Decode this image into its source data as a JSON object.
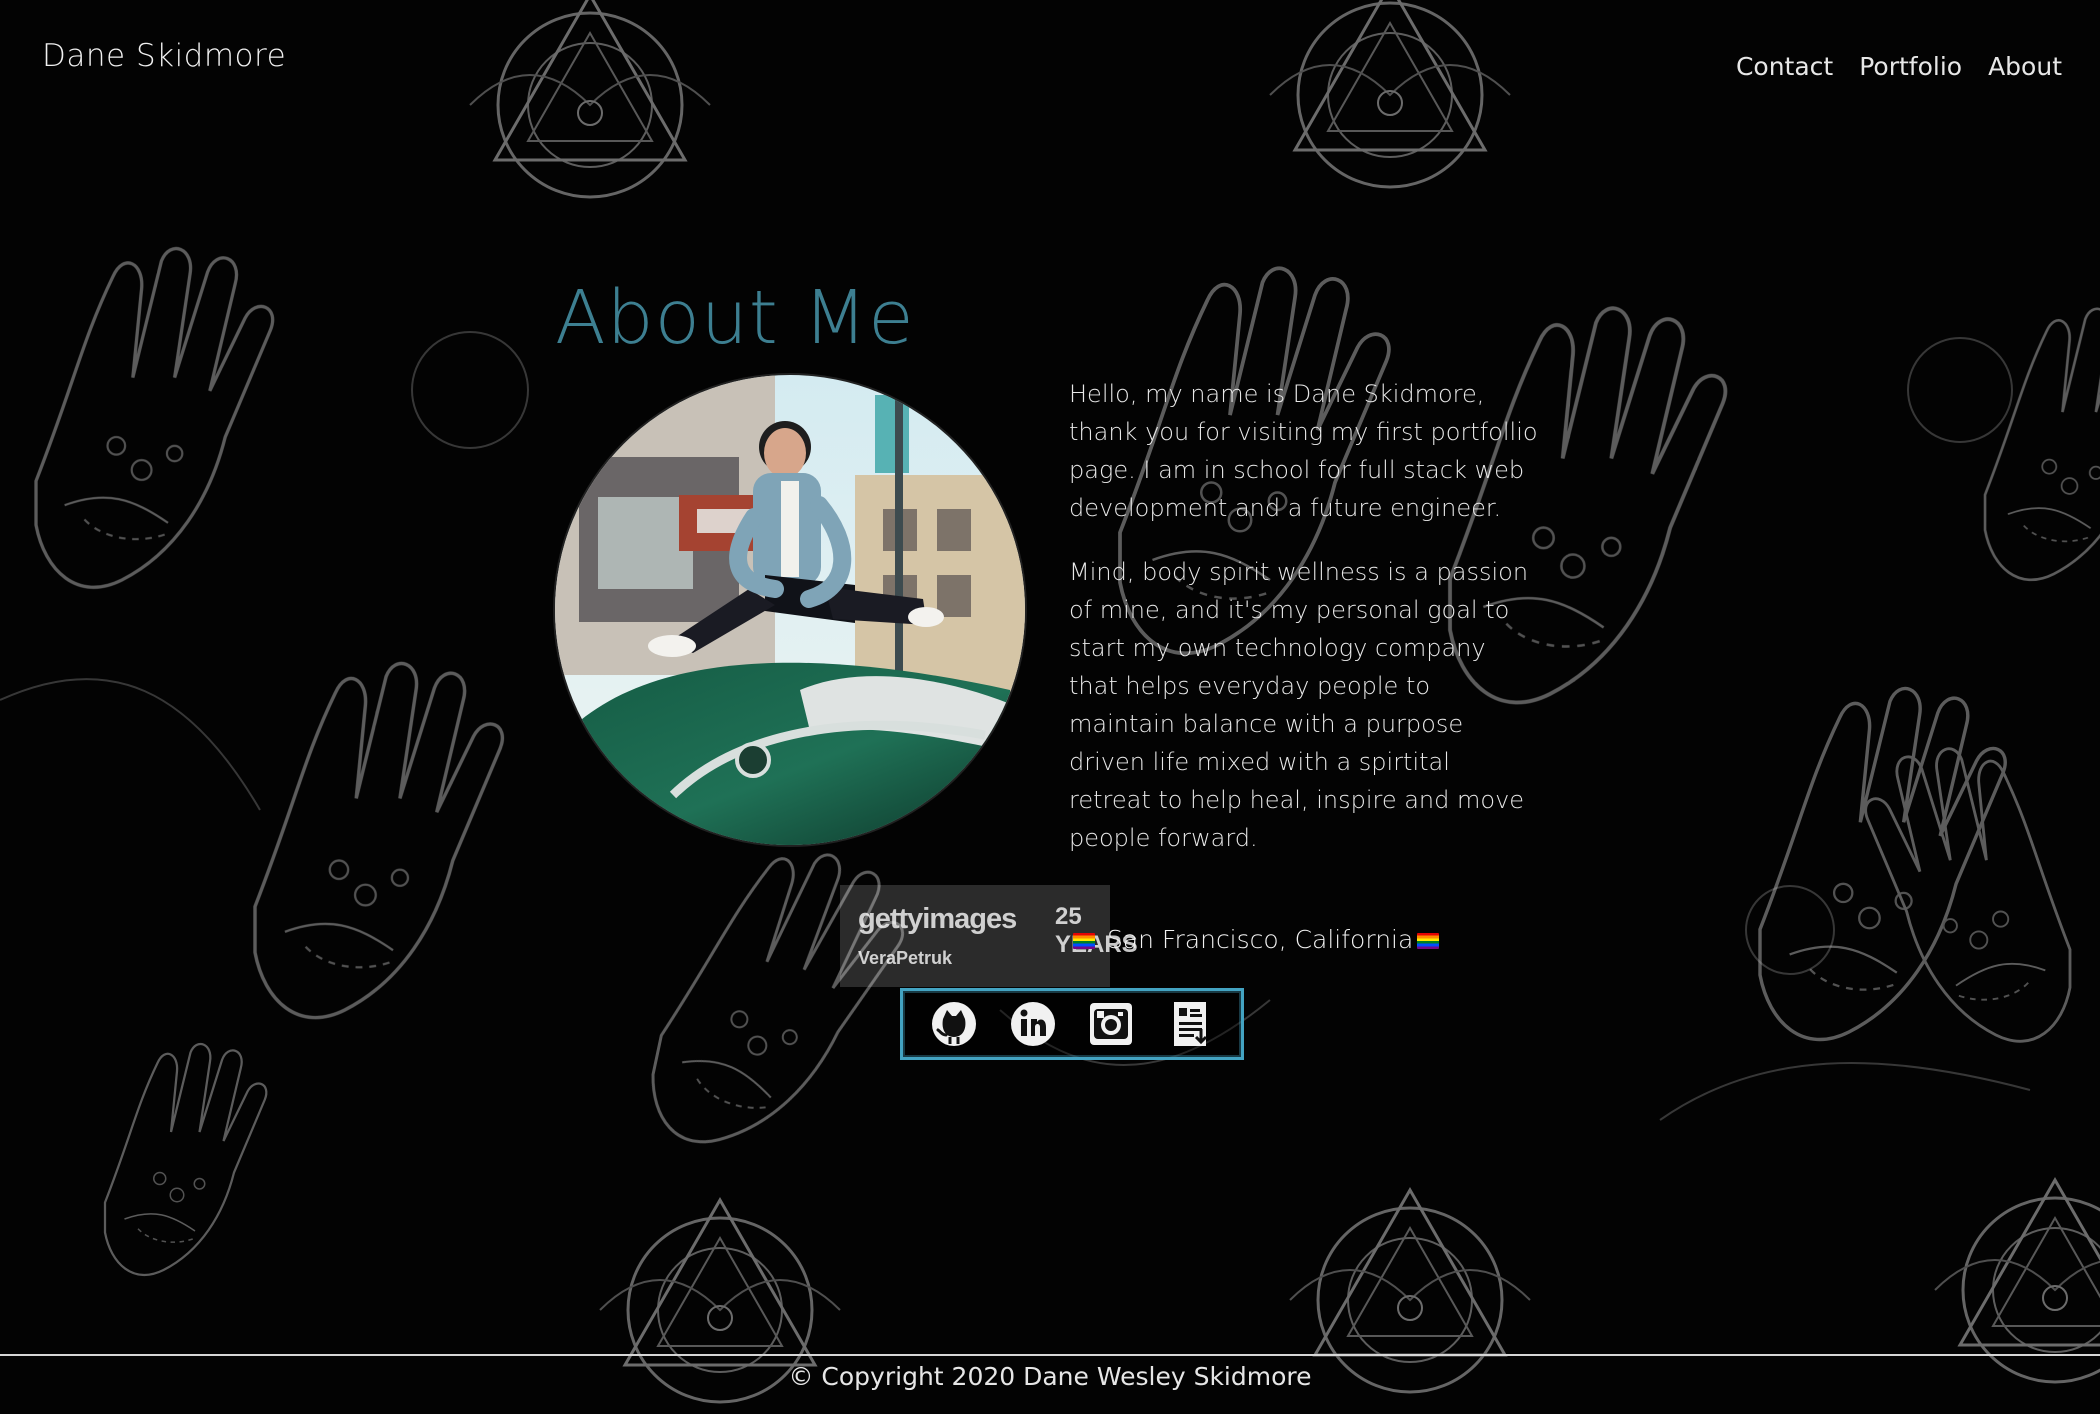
{
  "header": {
    "brand": "Dane Skidmore",
    "nav": [
      {
        "label": "Contact"
      },
      {
        "label": "Portfolio"
      },
      {
        "label": "About"
      }
    ]
  },
  "main": {
    "title": "About Me",
    "paragraphs": [
      "Hello, my name is Dane Skidmore, thank you for visiting my first portfollio page. I am in school for full stack web development and a future engineer.",
      "Mind, body spirit wellness is a passion of mine, and it's my personal goal to start my own technology company that helps everyday people to maintain balance with a purpose driven life mixed with a spirtital retreat to help heal, inspire and move people forward."
    ],
    "location": "San Francisco, California",
    "watermark": {
      "logo": "gettyimages",
      "years": "25 YEARS",
      "credit": "VeraPetruk"
    },
    "social": [
      {
        "name": "github",
        "icon": "github-icon"
      },
      {
        "name": "linkedin",
        "icon": "linkedin-icon"
      },
      {
        "name": "instagram",
        "icon": "instagram-icon"
      },
      {
        "name": "resume",
        "icon": "resume-icon"
      }
    ]
  },
  "footer": {
    "copyright": "© Copyright 2020 Dane Wesley Skidmore"
  },
  "colors": {
    "background": "#030303",
    "accent": "#3d7f91",
    "border_accent": "#43a3c2",
    "text": "#e8e8e8"
  }
}
